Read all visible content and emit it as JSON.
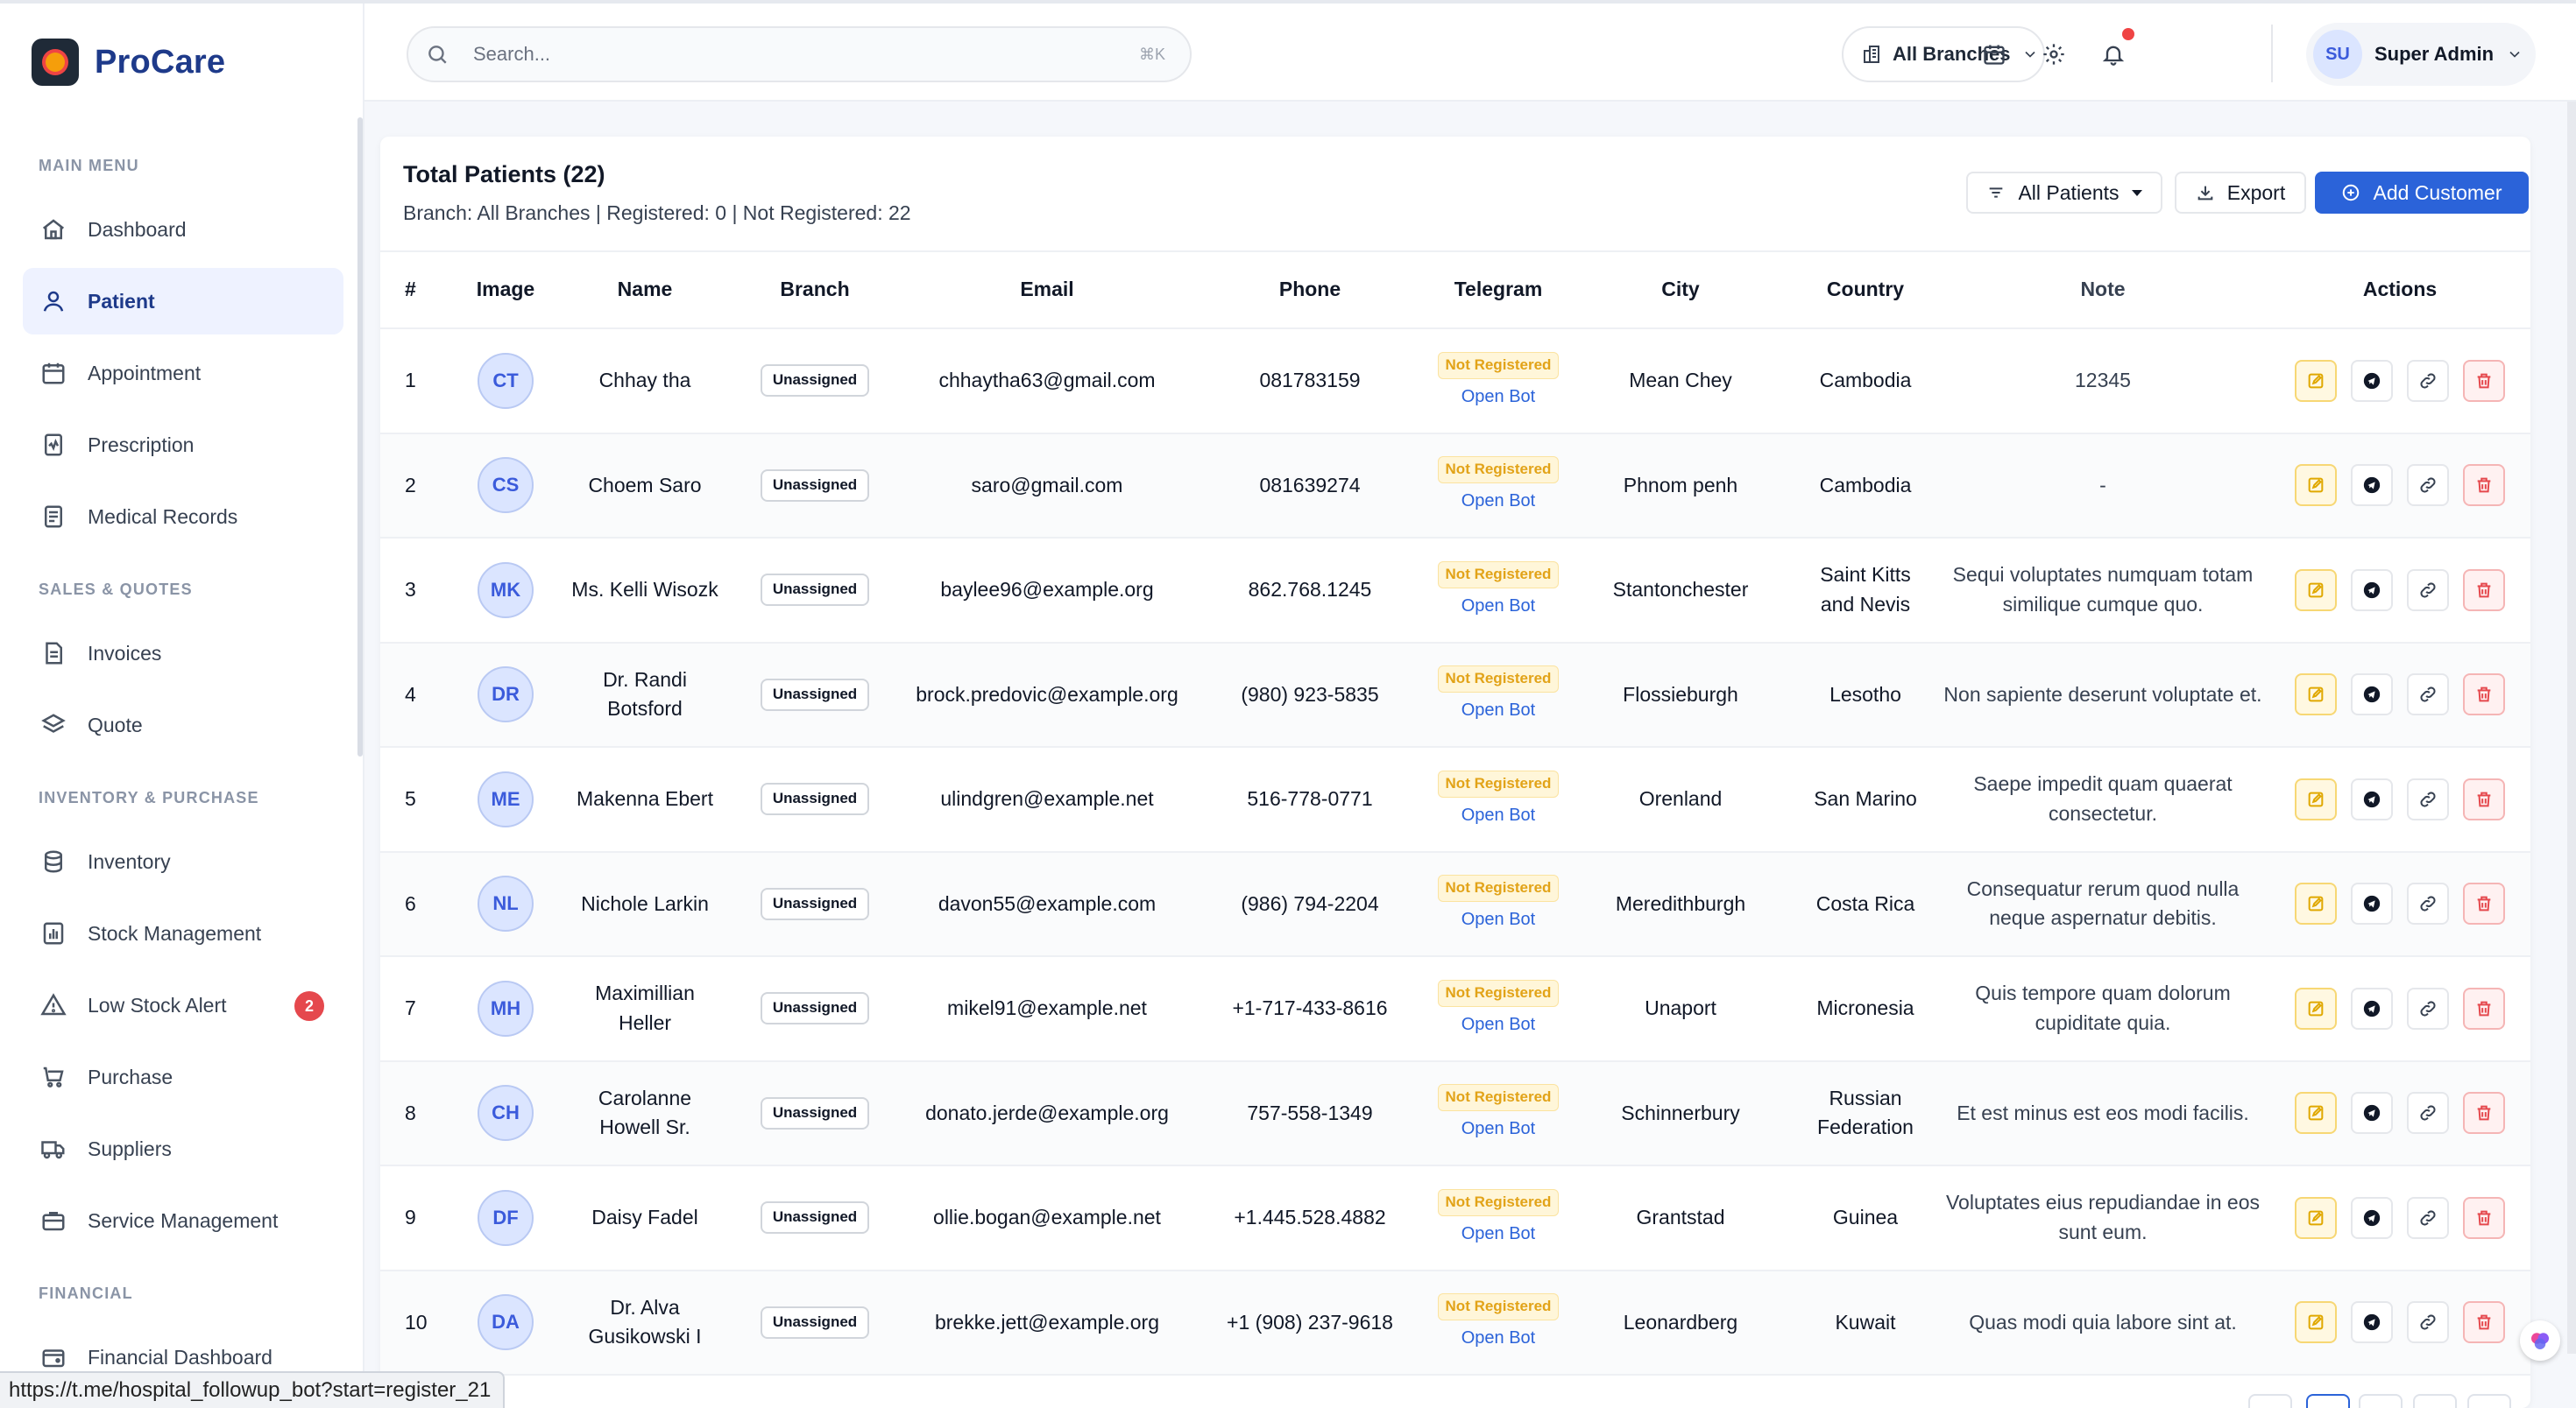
{
  "app": {
    "name": "ProCare"
  },
  "header": {
    "search_placeholder": "Search...",
    "search_shortcut": "⌘K",
    "branch_filter": "All Branches",
    "user": {
      "initials": "SU",
      "name": "Super Admin"
    }
  },
  "sidebar": {
    "sections": [
      {
        "title": "MAIN MENU",
        "items": [
          {
            "label": "Dashboard",
            "icon": "home-icon"
          },
          {
            "label": "Patient",
            "icon": "user-icon",
            "active": true
          },
          {
            "label": "Appointment",
            "icon": "calendar-icon"
          },
          {
            "label": "Prescription",
            "icon": "prescription-icon"
          },
          {
            "label": "Medical Records",
            "icon": "records-icon"
          }
        ]
      },
      {
        "title": "SALES & QUOTES",
        "items": [
          {
            "label": "Invoices",
            "icon": "invoice-icon"
          },
          {
            "label": "Quote",
            "icon": "layers-icon"
          }
        ]
      },
      {
        "title": "INVENTORY & PURCHASE",
        "items": [
          {
            "label": "Inventory",
            "icon": "database-icon"
          },
          {
            "label": "Stock Management",
            "icon": "bar-chart-icon"
          },
          {
            "label": "Low Stock Alert",
            "icon": "warning-icon",
            "badge": "2"
          },
          {
            "label": "Purchase",
            "icon": "cart-icon"
          },
          {
            "label": "Suppliers",
            "icon": "truck-icon"
          },
          {
            "label": "Service Management",
            "icon": "briefcase-icon"
          }
        ]
      },
      {
        "title": "FINANCIAL",
        "items": [
          {
            "label": "Financial Dashboard",
            "icon": "wallet-icon"
          }
        ]
      }
    ]
  },
  "main": {
    "title": "Total Patients (22)",
    "subtitle": "Branch: All Branches | Registered: 0 | Not Registered: 22",
    "filter_label": "All Patients",
    "export_label": "Export",
    "add_label": "Add Customer",
    "columns": [
      "#",
      "Image",
      "Name",
      "Branch",
      "Email",
      "Phone",
      "Telegram",
      "City",
      "Country",
      "Note",
      "Actions"
    ],
    "rows": [
      {
        "num": "1",
        "initials": "CT",
        "name": "Chhay tha",
        "branch": "Unassigned",
        "email": "chhaytha63@gmail.com",
        "phone": "081783159",
        "tg_status": "Not Registered",
        "tg_link": "Open Bot",
        "city": "Mean Chey",
        "country": "Cambodia",
        "note": "12345"
      },
      {
        "num": "2",
        "initials": "CS",
        "name": "Choem Saro",
        "branch": "Unassigned",
        "email": "saro@gmail.com",
        "phone": "081639274",
        "tg_status": "Not Registered",
        "tg_link": "Open Bot",
        "city": "Phnom penh",
        "country": "Cambodia",
        "note": "-"
      },
      {
        "num": "3",
        "initials": "MK",
        "name": "Ms. Kelli Wisozk",
        "branch": "Unassigned",
        "email": "baylee96@example.org",
        "phone": "862.768.1245",
        "tg_status": "Not Registered",
        "tg_link": "Open Bot",
        "city": "Stantonchester",
        "country": "Saint Kitts and Nevis",
        "note": "Sequi voluptates numquam totam similique cumque quo."
      },
      {
        "num": "4",
        "initials": "DR",
        "name": "Dr. Randi Botsford",
        "branch": "Unassigned",
        "email": "brock.predovic@example.org",
        "phone": "(980) 923-5835",
        "tg_status": "Not Registered",
        "tg_link": "Open Bot",
        "city": "Flossieburgh",
        "country": "Lesotho",
        "note": "Non sapiente deserunt voluptate et."
      },
      {
        "num": "5",
        "initials": "ME",
        "name": "Makenna Ebert",
        "branch": "Unassigned",
        "email": "ulindgren@example.net",
        "phone": "516-778-0771",
        "tg_status": "Not Registered",
        "tg_link": "Open Bot",
        "city": "Orenland",
        "country": "San Marino",
        "note": "Saepe impedit quam quaerat consectetur."
      },
      {
        "num": "6",
        "initials": "NL",
        "name": "Nichole Larkin",
        "branch": "Unassigned",
        "email": "davon55@example.com",
        "phone": "(986) 794-2204",
        "tg_status": "Not Registered",
        "tg_link": "Open Bot",
        "city": "Meredithburgh",
        "country": "Costa Rica",
        "note": "Consequatur rerum quod nulla neque aspernatur debitis."
      },
      {
        "num": "7",
        "initials": "MH",
        "name": "Maximillian Heller",
        "branch": "Unassigned",
        "email": "mikel91@example.net",
        "phone": "+1-717-433-8616",
        "tg_status": "Not Registered",
        "tg_link": "Open Bot",
        "city": "Unaport",
        "country": "Micronesia",
        "note": "Quis tempore quam dolorum cupiditate quia."
      },
      {
        "num": "8",
        "initials": "CH",
        "name": "Carolanne Howell Sr.",
        "branch": "Unassigned",
        "email": "donato.jerde@example.org",
        "phone": "757-558-1349",
        "tg_status": "Not Registered",
        "tg_link": "Open Bot",
        "city": "Schinnerbury",
        "country": "Russian Federation",
        "note": "Et est minus est eos modi facilis."
      },
      {
        "num": "9",
        "initials": "DF",
        "name": "Daisy Fadel",
        "branch": "Unassigned",
        "email": "ollie.bogan@example.net",
        "phone": "+1.445.528.4882",
        "tg_status": "Not Registered",
        "tg_link": "Open Bot",
        "city": "Grantstad",
        "country": "Guinea",
        "note": "Voluptates eius repudiandae in eos sunt eum."
      },
      {
        "num": "10",
        "initials": "DA",
        "name": "Dr. Alva Gusikowski I",
        "branch": "Unassigned",
        "email": "brekke.jett@example.org",
        "phone": "+1 (908) 237-9618",
        "tg_status": "Not Registered",
        "tg_link": "Open Bot",
        "city": "Leonardberg",
        "country": "Kuwait",
        "note": "Quas modi quia labore sint at."
      }
    ]
  },
  "status_bar": {
    "url": "https://t.me/hospital_followup_bot?start=register_21"
  },
  "colors": {
    "primary": "#2b63d9",
    "brand": "#1e3a8a",
    "warning": "#e2a318",
    "danger": "#e5484d"
  }
}
